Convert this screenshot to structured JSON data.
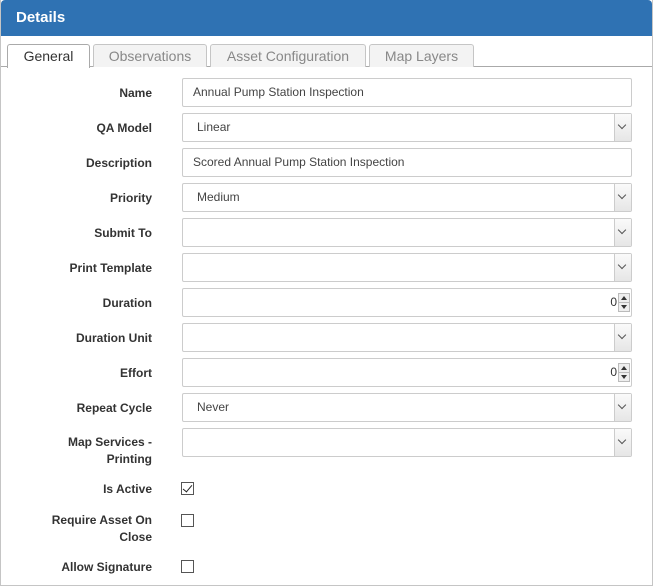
{
  "header": {
    "title": "Details"
  },
  "tabs": [
    {
      "label": "General"
    },
    {
      "label": "Observations"
    },
    {
      "label": "Asset Configuration"
    },
    {
      "label": "Map Layers"
    }
  ],
  "form": {
    "name": {
      "label": "Name",
      "value": "Annual Pump Station Inspection"
    },
    "qa_model": {
      "label": "QA Model",
      "value": "Linear"
    },
    "description": {
      "label": "Description",
      "value": "Scored Annual Pump Station Inspection"
    },
    "priority": {
      "label": "Priority",
      "value": "Medium"
    },
    "submit_to": {
      "label": "Submit To",
      "value": ""
    },
    "print_template": {
      "label": "Print Template",
      "value": ""
    },
    "duration": {
      "label": "Duration",
      "value": "0"
    },
    "duration_unit": {
      "label": "Duration Unit",
      "value": ""
    },
    "effort": {
      "label": "Effort",
      "value": "0"
    },
    "repeat_cycle": {
      "label": "Repeat Cycle",
      "value": "Never"
    },
    "map_services_printing": {
      "label_line1": "Map Services -",
      "label_line2": "Printing",
      "value": ""
    },
    "is_active": {
      "label": "Is Active",
      "checked": true
    },
    "require_asset_on_close": {
      "label_line1": "Require Asset On",
      "label_line2": "Close",
      "checked": false
    },
    "allow_signature": {
      "label": "Allow Signature",
      "checked": false
    }
  },
  "icons": {
    "dropdown": "chevron-down-icon",
    "spinner": "spinner-arrows-icon",
    "checkmark": "checkmark-icon"
  }
}
